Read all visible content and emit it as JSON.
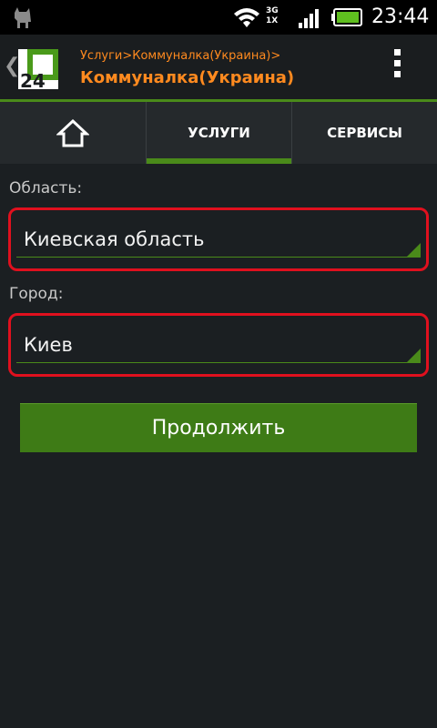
{
  "status_bar": {
    "time": "23:44",
    "network_top": "3G",
    "network_bottom": "1X",
    "icons": [
      "app-notification-icon",
      "wifi-icon",
      "network-type-icon",
      "signal-icon",
      "battery-icon"
    ]
  },
  "header": {
    "logo_text": "24",
    "breadcrumb": "Услуги>Коммуналка(Украина)>",
    "title": "Коммуналка(Украина)",
    "accent_color": "#ff8a1f",
    "brand_color": "#4a8a1a"
  },
  "tabs": {
    "home_icon": "home-icon",
    "services_label": "УСЛУГИ",
    "servisy_label": "СЕРВИСЫ",
    "active": "УСЛУГИ"
  },
  "form": {
    "oblast_label": "Область:",
    "oblast_value": "Киевская область",
    "gorod_label": "Город:",
    "gorod_value": "Киев",
    "highlight_color": "#e0101e"
  },
  "actions": {
    "continue_label": "Продолжить"
  }
}
